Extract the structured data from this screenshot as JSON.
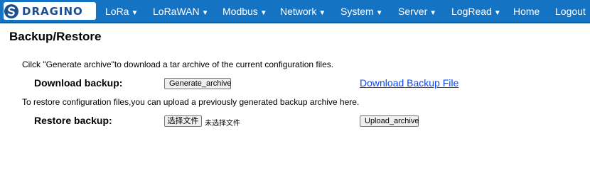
{
  "navbar": {
    "logo_text": "DRAGINO",
    "items": [
      {
        "label": "LoRa",
        "caret": "▼"
      },
      {
        "label": "LoRaWAN",
        "caret": "▼"
      },
      {
        "label": "Modbus",
        "caret": "▼"
      },
      {
        "label": "Network",
        "caret": "▼"
      },
      {
        "label": "System",
        "caret": "▼"
      },
      {
        "label": "Server",
        "caret": "▼"
      },
      {
        "label": "LogRead",
        "caret": "▼"
      },
      {
        "label": "Home",
        "caret": ""
      },
      {
        "label": "Logout",
        "caret": ""
      }
    ]
  },
  "page": {
    "title": "Backup/Restore",
    "backup_description": "Cilck \"Generate archive\"to download a tar archive of the current configuration files.",
    "download_label": "Download backup:",
    "generate_button": "Generate_archive",
    "download_link": "Download Backup File",
    "restore_description": "To restore configuration files,you can upload a previously generated backup archive here.",
    "restore_label": "Restore backup:",
    "choose_file_button": "选择文件",
    "file_status": "未选择文件",
    "upload_button": "Upload_archive"
  },
  "colors": {
    "navbar": "#1573c4",
    "link": "#0645ff"
  }
}
